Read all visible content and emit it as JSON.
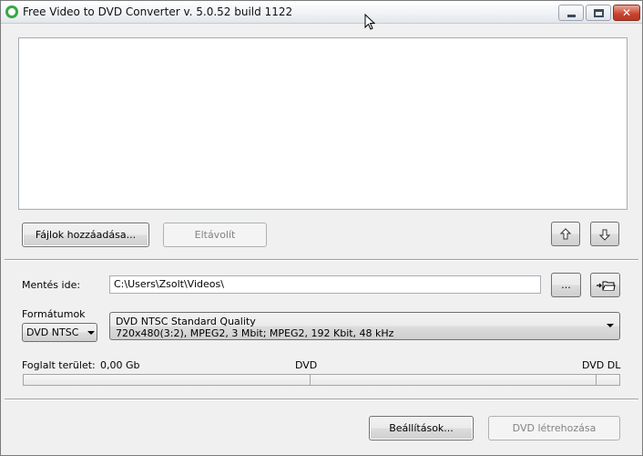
{
  "window": {
    "title": "Free Video to DVD Converter  v. 5.0.52 build 1122",
    "close_glyph": "✕"
  },
  "file_buttons": {
    "add_files": "Fájlok hozzáadása...",
    "remove": "Eltávolít"
  },
  "save_to": {
    "label": "Mentés ide:",
    "path": "C:\\Users\\Zsolt\\Videos\\",
    "browse_label": "..."
  },
  "format": {
    "label": "Formátumok",
    "selected": "DVD NTSC",
    "profile_name": "DVD NTSC Standard Quality",
    "profile_details": "720x480(3:2), MPEG2, 3 Mbit; MPEG2, 192 Kbit, 48 kHz"
  },
  "space": {
    "label": "Foglalt terület:",
    "value": "0,00 Gb",
    "marker_dvd": "DVD",
    "marker_dvd_dl": "DVD DL",
    "used_fraction": 0
  },
  "bottom_buttons": {
    "settings": "Beállítások...",
    "create_dvd": "DVD létrehozása"
  },
  "icons": {
    "app": "app-logo-icon",
    "move_up": "arrow-up-icon",
    "move_down": "arrow-down-icon",
    "open_folder": "open-folder-icon"
  }
}
